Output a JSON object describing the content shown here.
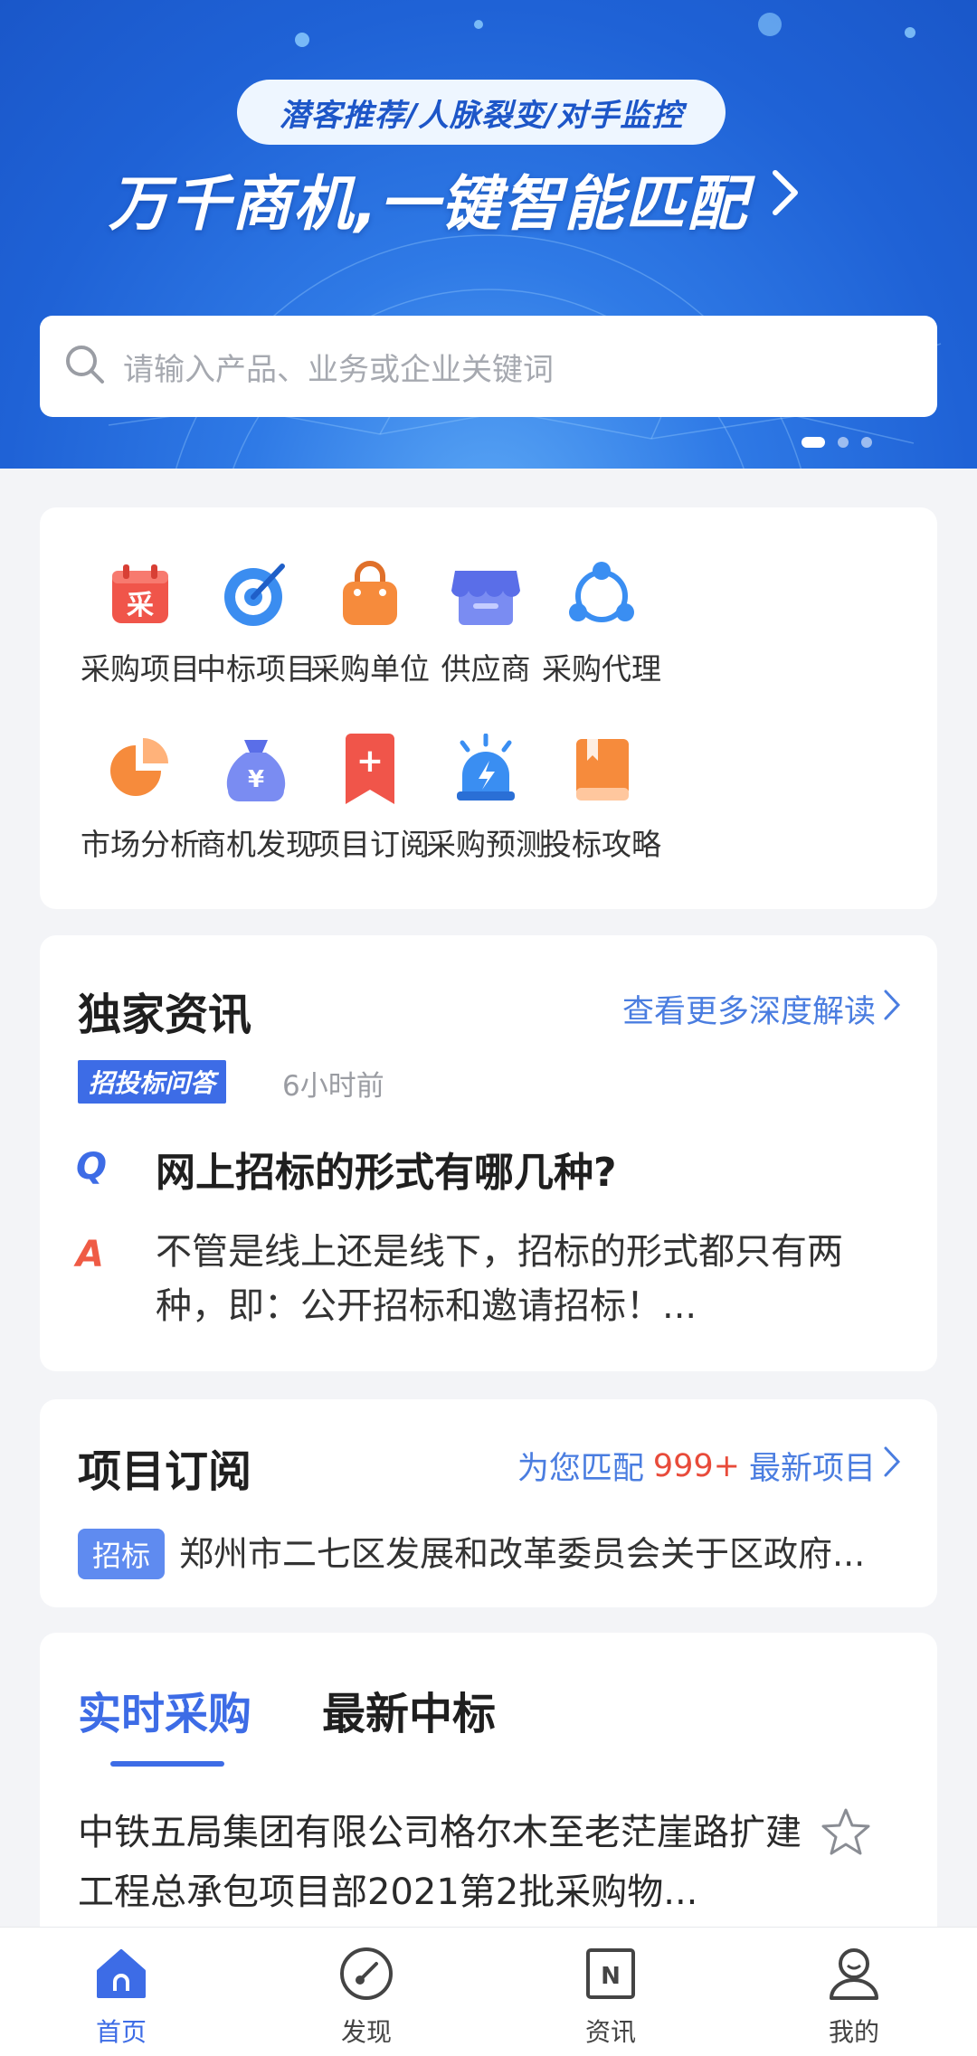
{
  "banner": {
    "pill_text": "潜客推荐/人脉裂变/对手监控",
    "slogan": "万千商机,一键智能匹配",
    "search_placeholder": "请输入产品、业务或企业关键词"
  },
  "grid": {
    "items": [
      {
        "label": "采购项目",
        "icon": "purchase-calendar-icon",
        "icon_char": "采",
        "color": "#f0554a"
      },
      {
        "label": "中标项目",
        "icon": "target-icon",
        "color": "#3b8df0"
      },
      {
        "label": "采购单位",
        "icon": "shopping-bag-icon",
        "color": "#f5893a"
      },
      {
        "label": "供应商",
        "icon": "store-icon",
        "color": "#6b7df0"
      },
      {
        "label": "采购代理",
        "icon": "network-icon",
        "color": "#3a8ef2"
      },
      {
        "label": "市场分析",
        "icon": "pie-chart-icon",
        "color": "#f68b3c"
      },
      {
        "label": "商机发现",
        "icon": "money-bag-icon",
        "icon_char": "¥",
        "color": "#6b7df0"
      },
      {
        "label": "项目订阅",
        "icon": "bookmark-plus-icon",
        "icon_char": "+",
        "color": "#f0554a"
      },
      {
        "label": "采购预测",
        "icon": "alarm-icon",
        "color": "#3a8ef2"
      },
      {
        "label": "投标攻略",
        "icon": "book-icon",
        "color": "#f68b3c"
      }
    ]
  },
  "news": {
    "title": "独家资讯",
    "more": "查看更多深度解读",
    "tag": "招投标问答",
    "time": "6小时前",
    "q_mark": "Q",
    "a_mark": "A",
    "question": "网上招标的形式有哪几种?",
    "answer": "不管是线上还是线下，招标的形式都只有两种，即：公开招标和邀请招标！..."
  },
  "subscription": {
    "title": "项目订阅",
    "match_prefix": "为您匹配",
    "match_count": "999+",
    "match_suffix": "最新项目",
    "tag": "招标",
    "item": "郑州市二七区发展和改革委员会关于区政府..."
  },
  "tabs": {
    "active": "实时采购",
    "inactive": "最新中标"
  },
  "list": {
    "item_title": "中铁五局集团有限公司格尔木至老茫崖路扩建工程总承包项目部2021第2批采购物..."
  },
  "bottom_nav": [
    {
      "label": "首页",
      "icon": "home-icon"
    },
    {
      "label": "发现",
      "icon": "compass-icon"
    },
    {
      "label": "资讯",
      "icon": "news-icon",
      "icon_char": "N"
    },
    {
      "label": "我的",
      "icon": "profile-icon"
    }
  ],
  "colors": {
    "accent": "#3d6ce6",
    "highlight": "#e84b3a"
  }
}
